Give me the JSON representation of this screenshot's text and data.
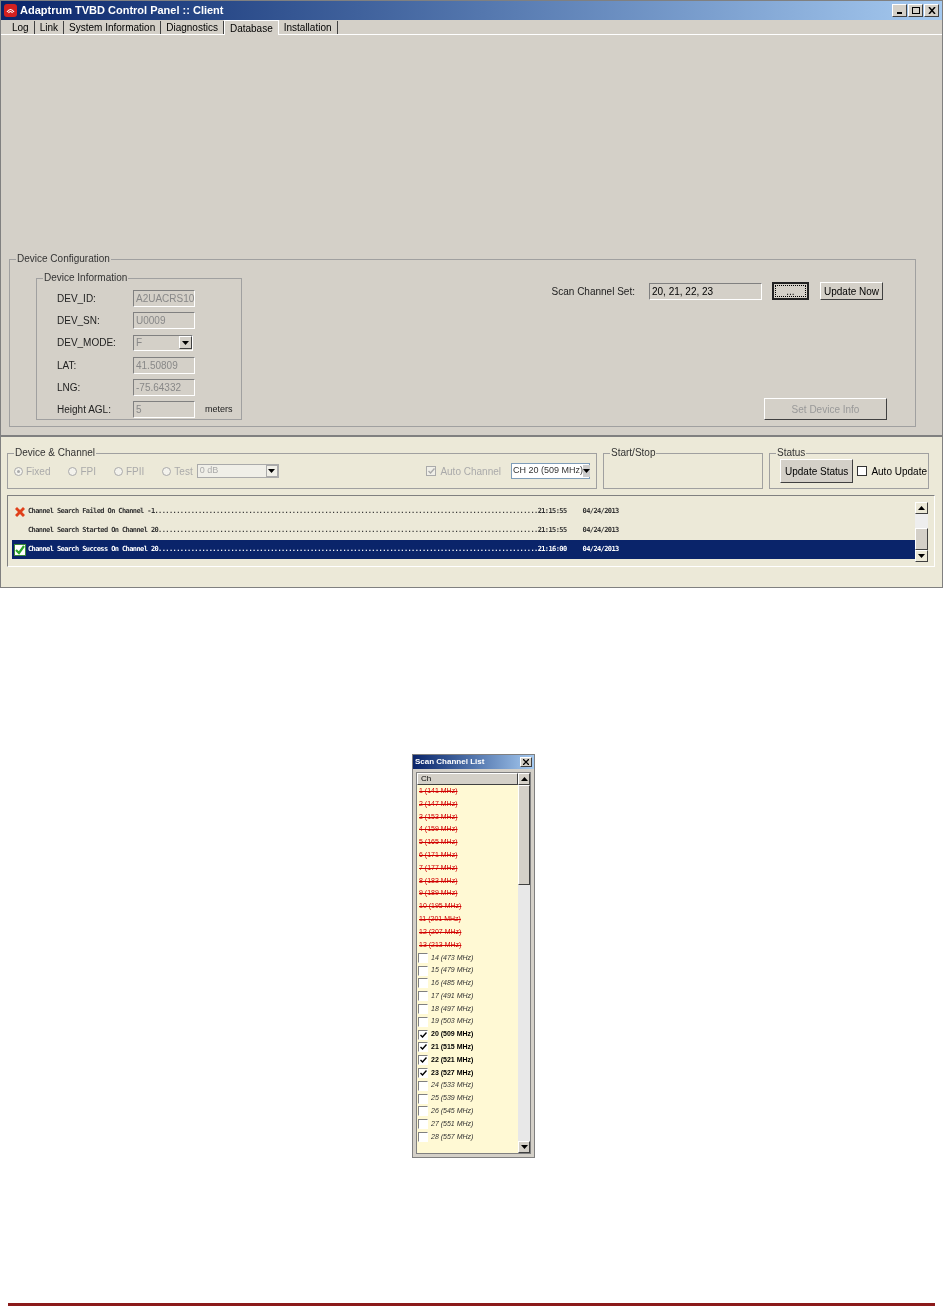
{
  "window": {
    "title": "Adaptrum TVBD Control Panel :: Client"
  },
  "tabs": [
    {
      "label": "Log",
      "selected": false
    },
    {
      "label": "Link",
      "selected": false
    },
    {
      "label": "System Information",
      "selected": false
    },
    {
      "label": "Diagnostics",
      "selected": false
    },
    {
      "label": "Database",
      "selected": true
    },
    {
      "label": "Installation",
      "selected": false
    }
  ],
  "device_configuration": {
    "title": "Device Configuration",
    "device_information": {
      "title": "Device Information",
      "disabled": true,
      "fields": [
        {
          "label": "DEV_ID:",
          "value": "A2UACRS10",
          "kind": "text"
        },
        {
          "label": "DEV_SN:",
          "value": "U0009",
          "kind": "text"
        },
        {
          "label": "DEV_MODE:",
          "value": "F",
          "kind": "dropdown"
        },
        {
          "label": "LAT:",
          "value": "41.50809",
          "kind": "text"
        },
        {
          "label": "LNG:",
          "value": "-75.64332",
          "kind": "text"
        },
        {
          "label": "Height AGL:",
          "value": "5",
          "kind": "text",
          "unit": "meters"
        }
      ]
    },
    "scan_channel_set": {
      "label": "Scan Channel Set:",
      "value": "20, 21, 22, 23",
      "browse_button": "...",
      "update_button": "Update Now"
    },
    "set_device_info_button": {
      "label": "Set Device Info",
      "disabled": true
    }
  },
  "device_channel": {
    "title": "Device & Channel",
    "radios": [
      {
        "label": "Fixed",
        "selected": true
      },
      {
        "label": "FPI",
        "selected": false
      },
      {
        "label": "FPII",
        "selected": false
      },
      {
        "label": "Test",
        "selected": false
      }
    ],
    "test_level": "0 dB",
    "auto_channel": {
      "label": "Auto Channel",
      "checked": true
    },
    "channel": "CH 20 (509 MHz)"
  },
  "start_stop": {
    "title": "Start/Stop"
  },
  "status": {
    "title": "Status",
    "button": "Update Status",
    "auto_update": {
      "label": "Auto Update",
      "checked": false
    }
  },
  "log": [
    {
      "kind": "error",
      "message": "Channel Search Failed On Channel -1..........................................................................................................21:15:55",
      "date": "04/24/2013",
      "selected": false
    },
    {
      "kind": "info",
      "message": "Channel Search Started On Channel 20.........................................................................................................21:15:55",
      "date": "04/24/2013",
      "selected": false
    },
    {
      "kind": "success",
      "message": "Channel Search Success On Channel 20.........................................................................................................21:16:00",
      "date": "04/24/2013",
      "selected": true
    }
  ],
  "scan_channel_list": {
    "title": "Scan Channel List",
    "column": "Ch",
    "channels": [
      {
        "label": "1 (141 MHz)",
        "kind": "unavailable"
      },
      {
        "label": "2 (147 MHz)",
        "kind": "unavailable"
      },
      {
        "label": "3 (153 MHz)",
        "kind": "unavailable"
      },
      {
        "label": "4 (159 MHz)",
        "kind": "unavailable"
      },
      {
        "label": "5 (165 MHz)",
        "kind": "unavailable"
      },
      {
        "label": "6 (171 MHz)",
        "kind": "unavailable"
      },
      {
        "label": "7 (177 MHz)",
        "kind": "unavailable"
      },
      {
        "label": "8 (183 MHz)",
        "kind": "unavailable"
      },
      {
        "label": "9 (189 MHz)",
        "kind": "unavailable"
      },
      {
        "label": "10 (195 MHz)",
        "kind": "unavailable"
      },
      {
        "label": "11 (201 MHz)",
        "kind": "unavailable"
      },
      {
        "label": "12 (207 MHz)",
        "kind": "unavailable"
      },
      {
        "label": "13 (213 MHz)",
        "kind": "unavailable"
      },
      {
        "label": "14 (473 MHz)",
        "kind": "available",
        "checked": false
      },
      {
        "label": "15 (479 MHz)",
        "kind": "available",
        "checked": false
      },
      {
        "label": "16 (485 MHz)",
        "kind": "available",
        "checked": false
      },
      {
        "label": "17 (491 MHz)",
        "kind": "available",
        "checked": false
      },
      {
        "label": "18 (497 MHz)",
        "kind": "available",
        "checked": false
      },
      {
        "label": "19 (503 MHz)",
        "kind": "available",
        "checked": false
      },
      {
        "label": "20 (509 MHz)",
        "kind": "available",
        "checked": true
      },
      {
        "label": "21 (515 MHz)",
        "kind": "available",
        "checked": true
      },
      {
        "label": "22 (521 MHz)",
        "kind": "available",
        "checked": true
      },
      {
        "label": "23 (527 MHz)",
        "kind": "available",
        "checked": true
      },
      {
        "label": "24 (533 MHz)",
        "kind": "available",
        "checked": false
      },
      {
        "label": "25 (539 MHz)",
        "kind": "available",
        "checked": false
      },
      {
        "label": "26 (545 MHz)",
        "kind": "available",
        "checked": false
      },
      {
        "label": "27 (551 MHz)",
        "kind": "available",
        "checked": false
      },
      {
        "label": "28 (557 MHz)",
        "kind": "available",
        "checked": false
      }
    ]
  }
}
